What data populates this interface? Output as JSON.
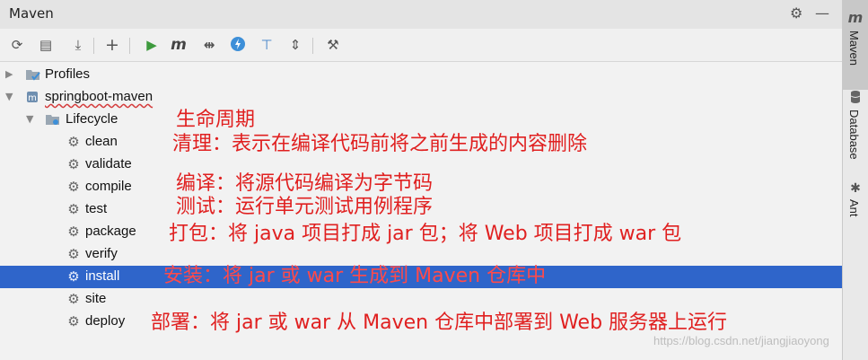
{
  "window": {
    "title": "Maven",
    "settings_icon": "gear-icon",
    "hide_icon": "minimize-icon"
  },
  "toolbar": {
    "items": [
      {
        "name": "reload-all-button",
        "icon": "refresh-icon",
        "glyph": "⟳"
      },
      {
        "name": "generate-sources-button",
        "icon": "folder-refresh-icon",
        "glyph": "▤"
      },
      {
        "name": "download-sources-button",
        "icon": "download-icon",
        "glyph": "⤓"
      },
      {
        "name": "add-project-button",
        "icon": "plus-icon",
        "glyph": "+"
      },
      {
        "name": "run-goal-button",
        "icon": "run-icon",
        "glyph": "▶"
      },
      {
        "name": "execute-goal-button",
        "icon": "maven-m-icon",
        "glyph": "m"
      },
      {
        "name": "toggle-offline-button",
        "icon": "toggle-offline-icon",
        "glyph": "⇹"
      },
      {
        "name": "skip-tests-button",
        "icon": "lightning-icon",
        "glyph": "ϟ"
      },
      {
        "name": "show-dependencies-button",
        "icon": "dependencies-icon",
        "glyph": "⊤"
      },
      {
        "name": "collapse-all-button",
        "icon": "collapse-icon",
        "glyph": "⇕"
      },
      {
        "name": "maven-settings-button",
        "icon": "wrench-icon",
        "glyph": "⚒"
      }
    ]
  },
  "tree": {
    "profiles": "Profiles",
    "project": "springboot-maven",
    "lifecycle": "Lifecycle",
    "goals": [
      "clean",
      "validate",
      "compile",
      "test",
      "package",
      "verify",
      "install",
      "site",
      "deploy"
    ],
    "selected": "install"
  },
  "annotations": {
    "lifecycle": "生命周期",
    "clean": "清理：表示在编译代码前将之前生成的内容删除",
    "compile": "编译：将源代码编译为字节码",
    "test": "测试：运行单元测试用例程序",
    "package": "打包：将 java 项目打成 jar 包；将 Web 项目打成 war 包",
    "install": "安装：将 jar 或 war 生成到 Maven 仓库中",
    "deploy": "部署：将 jar 或 war 从 Maven 仓库中部署到 Web 服务器上运行"
  },
  "watermark": "https://blog.csdn.net/jiangjiaoyong",
  "sidebar": {
    "tabs": [
      {
        "label": "Maven",
        "icon": "maven-m-icon",
        "active": true
      },
      {
        "label": "Database",
        "icon": "database-icon",
        "active": false
      },
      {
        "label": "Ant",
        "icon": "ant-icon",
        "active": false
      }
    ]
  },
  "colors": {
    "selection": "#2f65ca",
    "annotation": "#e02020",
    "run_green": "#3d9a3d",
    "lightning_blue": "#3d8fd8"
  }
}
